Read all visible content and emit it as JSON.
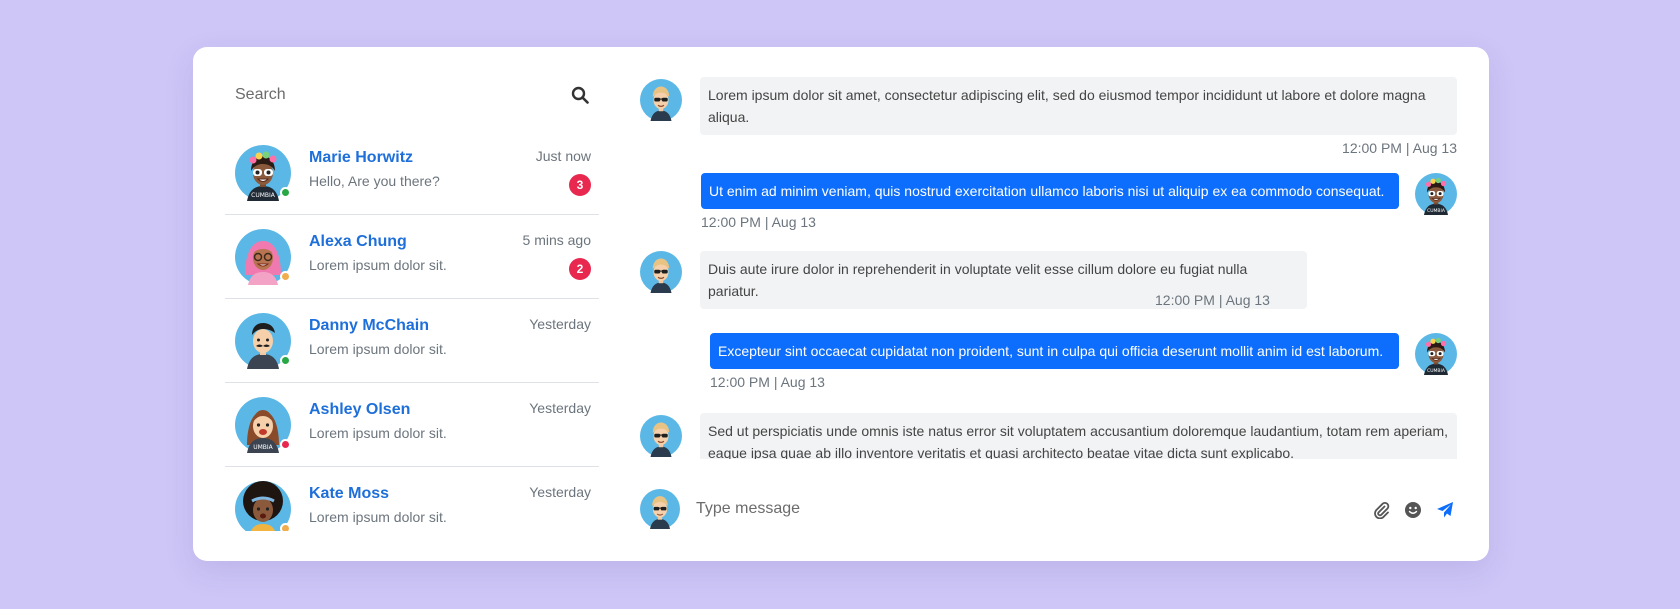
{
  "search": {
    "placeholder": "Search"
  },
  "conversations": [
    {
      "name": "Marie Horwitz",
      "preview": "Hello, Are you there?",
      "time": "Just now",
      "unread": "3",
      "status": "online"
    },
    {
      "name": "Alexa Chung",
      "preview": "Lorem ipsum dolor sit.",
      "time": "5 mins ago",
      "unread": "2",
      "status": "away"
    },
    {
      "name": "Danny McChain",
      "preview": "Lorem ipsum dolor sit.",
      "time": "Yesterday",
      "unread": "",
      "status": "online"
    },
    {
      "name": "Ashley Olsen",
      "preview": "Lorem ipsum dolor sit.",
      "time": "Yesterday",
      "unread": "",
      "status": "busy"
    },
    {
      "name": "Kate Moss",
      "preview": "Lorem ipsum dolor sit.",
      "time": "Yesterday",
      "unread": "",
      "status": "away"
    }
  ],
  "messages": [
    {
      "from": "them",
      "text": "Lorem ipsum dolor sit amet, consectetur adipiscing elit, sed do eiusmod tempor incididunt ut labore et dolore magna aliqua.",
      "time": "12:00 PM | Aug 13"
    },
    {
      "from": "me",
      "text": "Ut enim ad minim veniam, quis nostrud exercitation ullamco laboris nisi ut aliquip ex ea commodo consequat.",
      "time": "12:00 PM | Aug 13"
    },
    {
      "from": "them",
      "text": "Duis aute irure dolor in reprehenderit in voluptate velit esse cillum dolore eu fugiat nulla pariatur.",
      "time": "12:00 PM | Aug 13"
    },
    {
      "from": "me",
      "text": "Excepteur sint occaecat cupidatat non proident, sunt in culpa qui officia deserunt mollit anim id est laborum.",
      "time": "12:00 PM | Aug 13"
    },
    {
      "from": "them",
      "text": "Sed ut perspiciatis unde omnis iste natus error sit voluptatem accusantium doloremque laudantium, totam rem aperiam, eaque ipsa quae ab illo inventore veritatis et quasi architecto beatae vitae dicta sunt explicabo.",
      "time": ""
    }
  ],
  "composer": {
    "placeholder": "Type message"
  },
  "colors": {
    "background": "#cdc6f6",
    "accent": "#0d6efd",
    "name": "#1e6fd9",
    "badge": "#e8284f",
    "online": "#28a745",
    "away": "#f0ad4e",
    "busy": "#e8284f"
  },
  "icons": [
    "search-icon",
    "paperclip-icon",
    "smile-icon",
    "send-icon"
  ]
}
